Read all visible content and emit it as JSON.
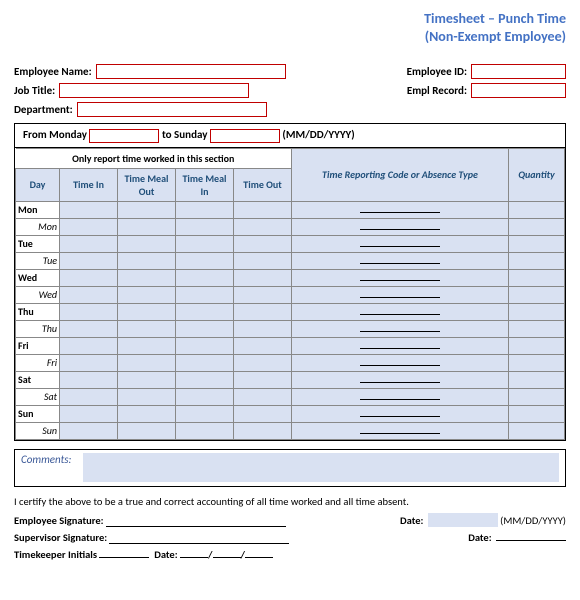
{
  "title_line1": "Timesheet – Punch Time",
  "title_line2": "(Non-Exempt Employee)",
  "labels": {
    "employee_name": "Employee Name:",
    "job_title": "Job Title:",
    "department": "Department:",
    "employee_id": "Employee ID:",
    "empl_record": "Empl Record:"
  },
  "range": {
    "from": "From Monday",
    "to": "to Sunday",
    "fmt": "(MM/DD/YYYY)"
  },
  "section_head": "Only report time worked in this section",
  "cols": {
    "day": "Day",
    "tin": "Time In",
    "tmo": "Time Meal Out",
    "tmi": "Time Meal In",
    "tout": "Time Out",
    "code": "Time Reporting Code or Absence Type",
    "qty": "Quantity"
  },
  "days": [
    "Mon",
    "Tue",
    "Wed",
    "Thu",
    "Fri",
    "Sat",
    "Sun"
  ],
  "comments": "Comments:",
  "cert": "I certify the above to be a true and correct accounting of all time worked and all time absent.",
  "sig": {
    "emp": "Employee Signature:",
    "sup": "Supervisor Signature:",
    "date": "Date:",
    "fmt": "(MM/DD/YYYY)",
    "tk": "Timekeeper Initials",
    "tk_date": "Date:"
  }
}
